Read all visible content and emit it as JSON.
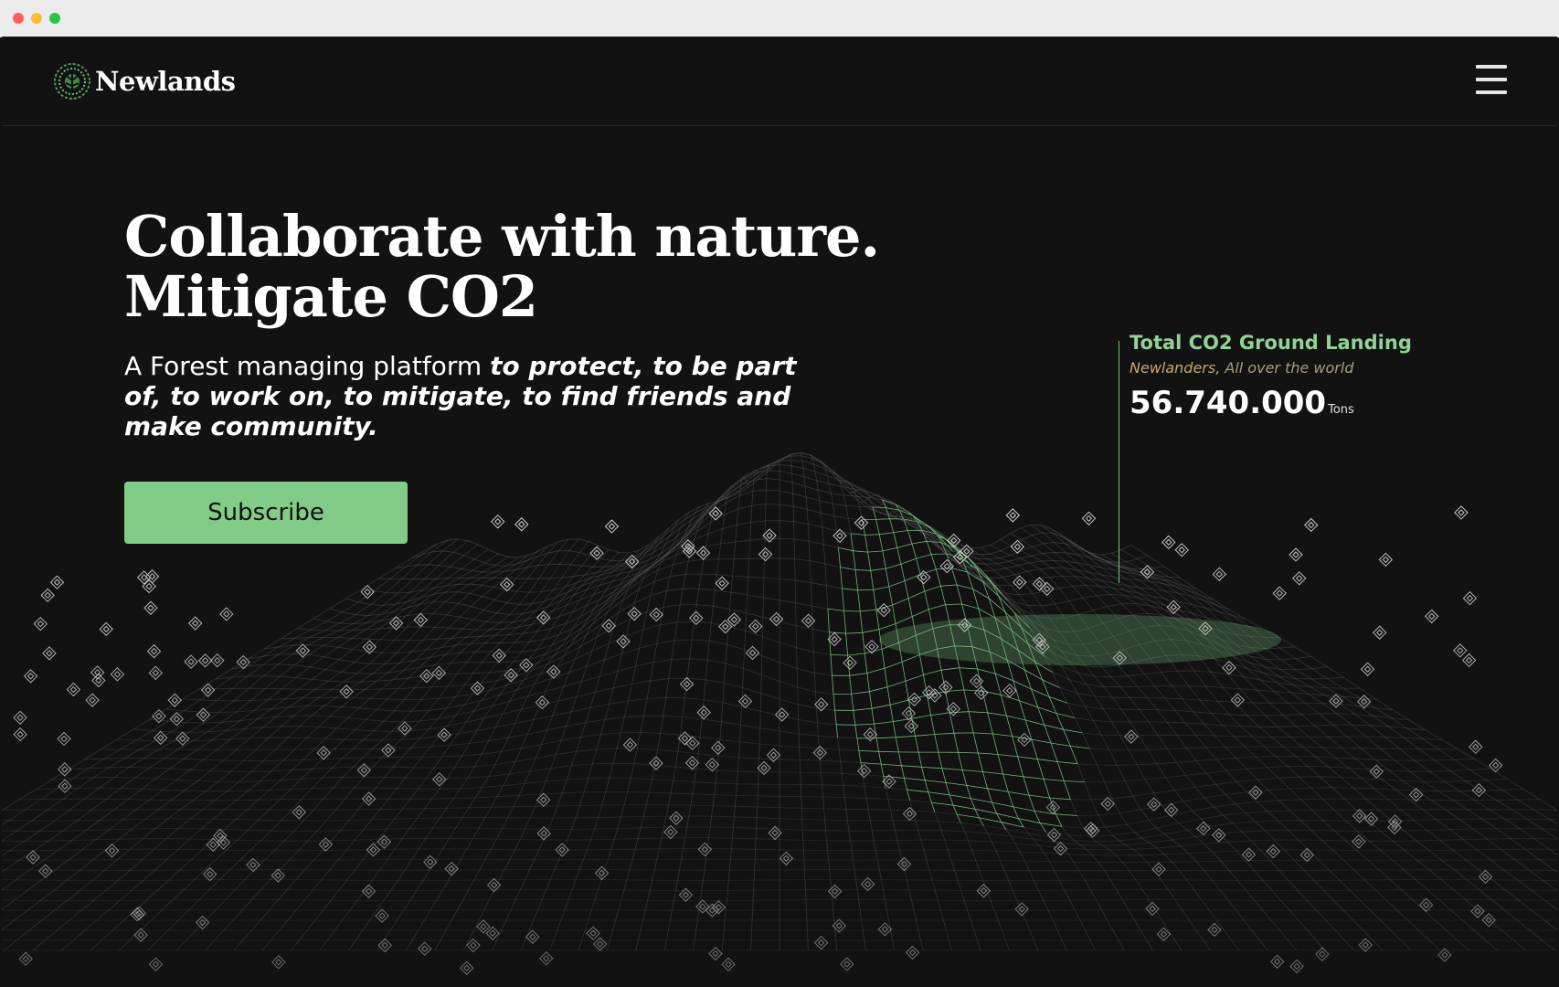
{
  "brand": {
    "name": "Newlands",
    "logo_icon": "tree-icon",
    "accent_color": "#82cc87"
  },
  "navbar": {
    "menu_icon": "hamburger-menu-icon"
  },
  "hero": {
    "title_line1": "Collaborate with nature.",
    "title_line2": "Mitigate CO2",
    "subtitle_plain": "A Forest managing platform ",
    "subtitle_emphasis": "to protect, to be part of, to work on, to mitigate, to find friends and make community.",
    "cta_label": "Subscribe"
  },
  "stat": {
    "title": "Total CO2 Ground Landing",
    "sub_highlight": "Newlanders,",
    "sub_rest": " All over the world",
    "value": "56.740.000",
    "unit": "Tons"
  },
  "terrain": {
    "marker_icon": "diamond-marker-icon",
    "line_color": "#5a5a5a",
    "highlight_color": "#7bc182"
  }
}
